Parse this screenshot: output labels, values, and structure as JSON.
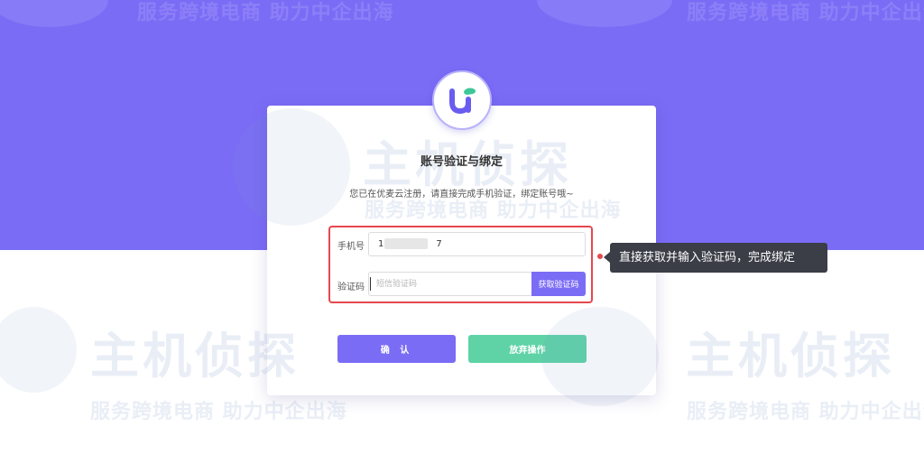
{
  "watermark": {
    "tagline": "服务跨境电商 助力中企出海",
    "brand": "主机侦探"
  },
  "dialog": {
    "title": "账号验证与绑定",
    "subtitle": "您已在优麦云注册，请直接完成手机验证，绑定账号哦~",
    "phone_label": "手机号",
    "phone_value_prefix": "1",
    "phone_value_suffix": "7",
    "code_label": "验证码",
    "code_placeholder": "短信验证码",
    "get_code_label": "获取验证码",
    "confirm_label": "确 认",
    "abandon_label": "放弃操作"
  },
  "annotation": {
    "callout_text": "直接获取并输入验证码，完成绑定"
  },
  "colors": {
    "brand_purple": "#7b6cf6",
    "abandon_green": "#5fd3a6",
    "highlight_red": "#e5484d",
    "callout_bg": "#3b3d47"
  },
  "icons": {
    "logo": "youmai-u-logo-icon"
  }
}
